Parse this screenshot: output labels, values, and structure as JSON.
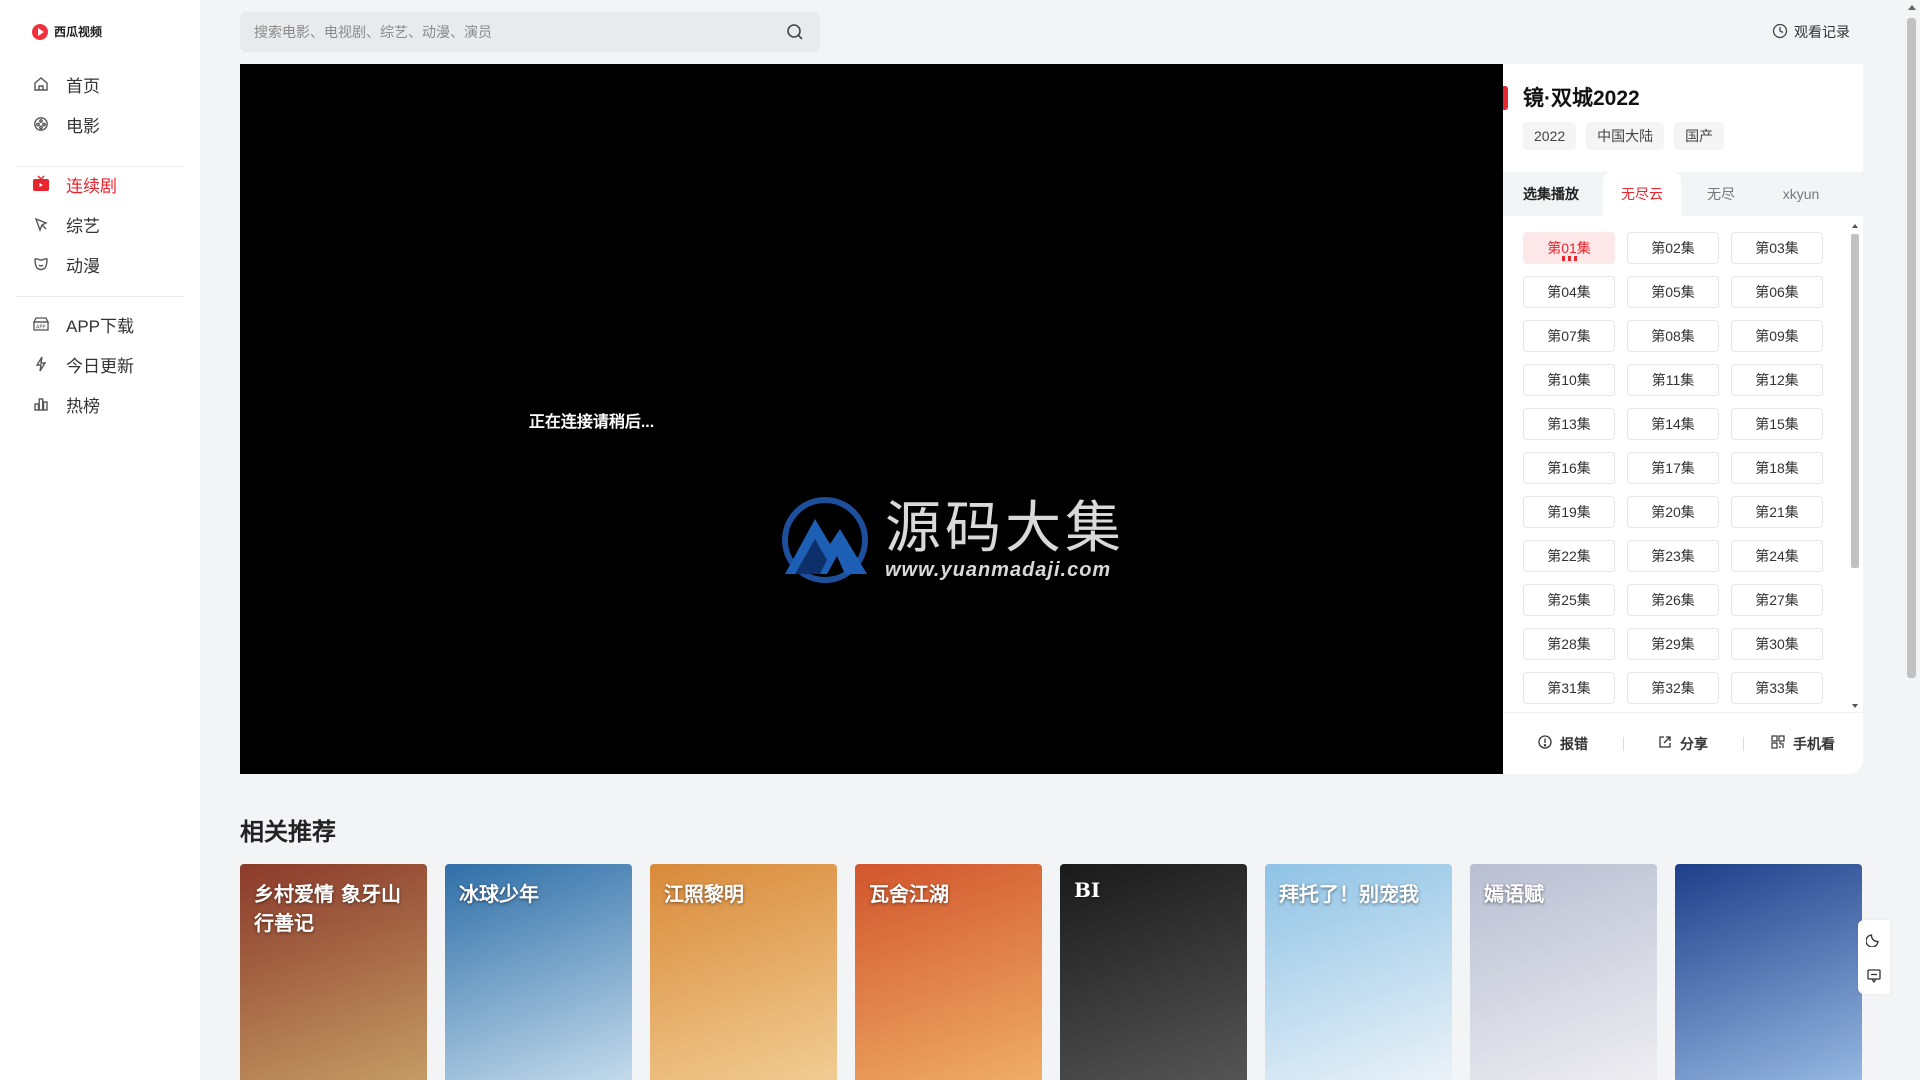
{
  "app": {
    "logo_text": "西瓜视频"
  },
  "sidebar": {
    "items": [
      {
        "label": "首页",
        "icon": "home-icon"
      },
      {
        "label": "电影",
        "icon": "film-reel-icon"
      },
      {
        "label": "连续剧",
        "icon": "tv-icon",
        "active": true
      },
      {
        "label": "综艺",
        "icon": "star-sparkle-icon"
      },
      {
        "label": "动漫",
        "icon": "bear-face-icon"
      },
      {
        "label": "APP下载",
        "icon": "app-download-icon"
      },
      {
        "label": "今日更新",
        "icon": "lightning-icon"
      },
      {
        "label": "热榜",
        "icon": "bar-chart-icon"
      }
    ]
  },
  "header": {
    "search_placeholder": "搜索电影、电视剧、综艺、动漫、演员",
    "history_label": "观看记录"
  },
  "player": {
    "status_text": "正在连接请稍后...",
    "watermark_cn": "源码大集",
    "watermark_en": "www.yuanmadaji.com"
  },
  "detail": {
    "title": "镜·双城2022",
    "tags": [
      "2022",
      "中国大陆",
      "国产"
    ],
    "tabs": {
      "label": "选集播放",
      "sources": [
        "无尽云",
        "无尽",
        "xkyun"
      ],
      "active_index": 0
    },
    "episodes": [
      "第01集",
      "第02集",
      "第03集",
      "第04集",
      "第05集",
      "第06集",
      "第07集",
      "第08集",
      "第09集",
      "第10集",
      "第11集",
      "第12集",
      "第13集",
      "第14集",
      "第15集",
      "第16集",
      "第17集",
      "第18集",
      "第19集",
      "第20集",
      "第21集",
      "第22集",
      "第23集",
      "第24集",
      "第25集",
      "第26集",
      "第27集",
      "第28集",
      "第29集",
      "第30集",
      "第31集",
      "第32集",
      "第33集"
    ],
    "active_episode": 0,
    "actions": {
      "report": "报错",
      "share": "分享",
      "mobile": "手机看"
    }
  },
  "recommend": {
    "title": "相关推荐",
    "posters": [
      {
        "text": "乡村爱情 象牙山行善记",
        "colors": [
          "#8b3a2a",
          "#c9a46a"
        ]
      },
      {
        "text": "冰球少年",
        "colors": [
          "#2f6fa8",
          "#cfe3f1"
        ]
      },
      {
        "text": "江照黎明",
        "colors": [
          "#d98a3a",
          "#f3d29a"
        ]
      },
      {
        "text": "瓦舍江湖",
        "colors": [
          "#d2552c",
          "#f1b56c"
        ]
      },
      {
        "text": "BI",
        "colors": [
          "#1a1a1a",
          "#5a5a5a"
        ]
      },
      {
        "text": "拜托了！别宠我",
        "colors": [
          "#8fc3e6",
          "#f2f6f9"
        ]
      },
      {
        "text": "嫣语赋",
        "colors": [
          "#b8bfd2",
          "#f3f1f4"
        ]
      },
      {
        "text": "",
        "colors": [
          "#1e3f8a",
          "#9fc1e8"
        ]
      }
    ]
  },
  "float": {
    "theme_icon": "moon-icon",
    "feedback_icon": "feedback-icon"
  }
}
